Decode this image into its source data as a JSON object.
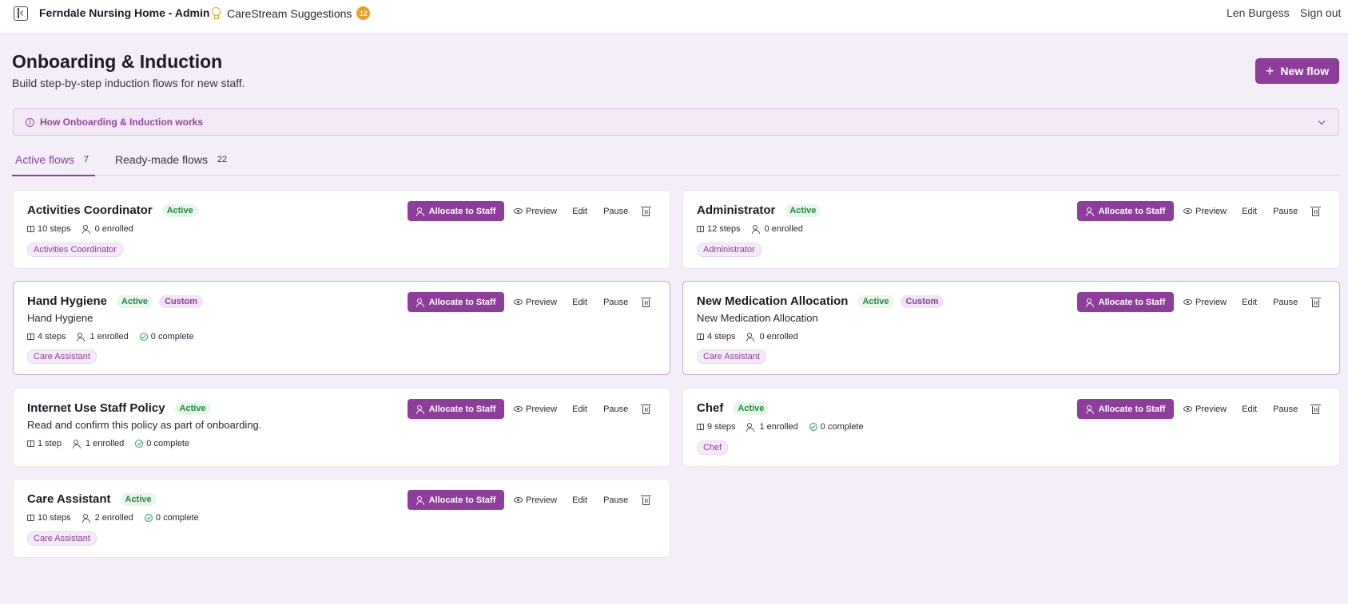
{
  "topbar": {
    "app_title": "Ferndale Nursing Home - Admin",
    "suggestions_label": "CareStream Suggestions",
    "suggestions_count": "12",
    "user_name": "Len Burgess",
    "signout_label": "Sign out"
  },
  "header": {
    "title": "Onboarding & Induction",
    "subtitle": "Build step-by-step induction flows for new staff.",
    "new_flow_label": "New flow",
    "new_flow_icon": "+"
  },
  "info": {
    "text": "How Onboarding & Induction works",
    "icon": "i"
  },
  "tabs": [
    {
      "label": "Active flows",
      "count": "7"
    },
    {
      "label": "Ready-made flows",
      "count": "22"
    }
  ],
  "actions": {
    "allocate": "Allocate to Staff",
    "preview": "Preview",
    "edit": "Edit",
    "pause": "Pause"
  },
  "cards": [
    {
      "name": "Activities Coordinator",
      "status": "Active",
      "custom": "",
      "description": "",
      "steps": "10 steps",
      "enrolled": "0 enrolled",
      "complete": "",
      "role": "Activities Coordinator"
    },
    {
      "name": "Administrator",
      "status": "Active",
      "custom": "",
      "description": "",
      "steps": "12 steps",
      "enrolled": "0 enrolled",
      "complete": "",
      "role": "Administrator"
    },
    {
      "name": "Hand Hygiene",
      "status": "Active",
      "custom": "Custom",
      "description": "Hand Hygiene",
      "steps": "4 steps",
      "enrolled": "1 enrolled",
      "complete": "0 complete",
      "role": "Care Assistant"
    },
    {
      "name": "New Medication Allocation",
      "status": "Active",
      "custom": "Custom",
      "description": "New Medication Allocation",
      "steps": "4 steps",
      "enrolled": "0 enrolled",
      "complete": "",
      "role": "Care Assistant"
    },
    {
      "name": "Internet Use Staff Policy",
      "status": "Active",
      "custom": "",
      "description": "Read and confirm this policy as part of onboarding.",
      "steps": "1 step",
      "enrolled": "1 enrolled",
      "complete": "0 complete",
      "role": ""
    },
    {
      "name": "Chef",
      "status": "Active",
      "custom": "",
      "description": "",
      "steps": "9 steps",
      "enrolled": "1 enrolled",
      "complete": "0 complete",
      "role": "Chef"
    },
    {
      "name": "Care Assistant",
      "status": "Active",
      "custom": "",
      "description": "",
      "steps": "10 steps",
      "enrolled": "2 enrolled",
      "complete": "0 complete",
      "role": "Care Assistant"
    }
  ]
}
